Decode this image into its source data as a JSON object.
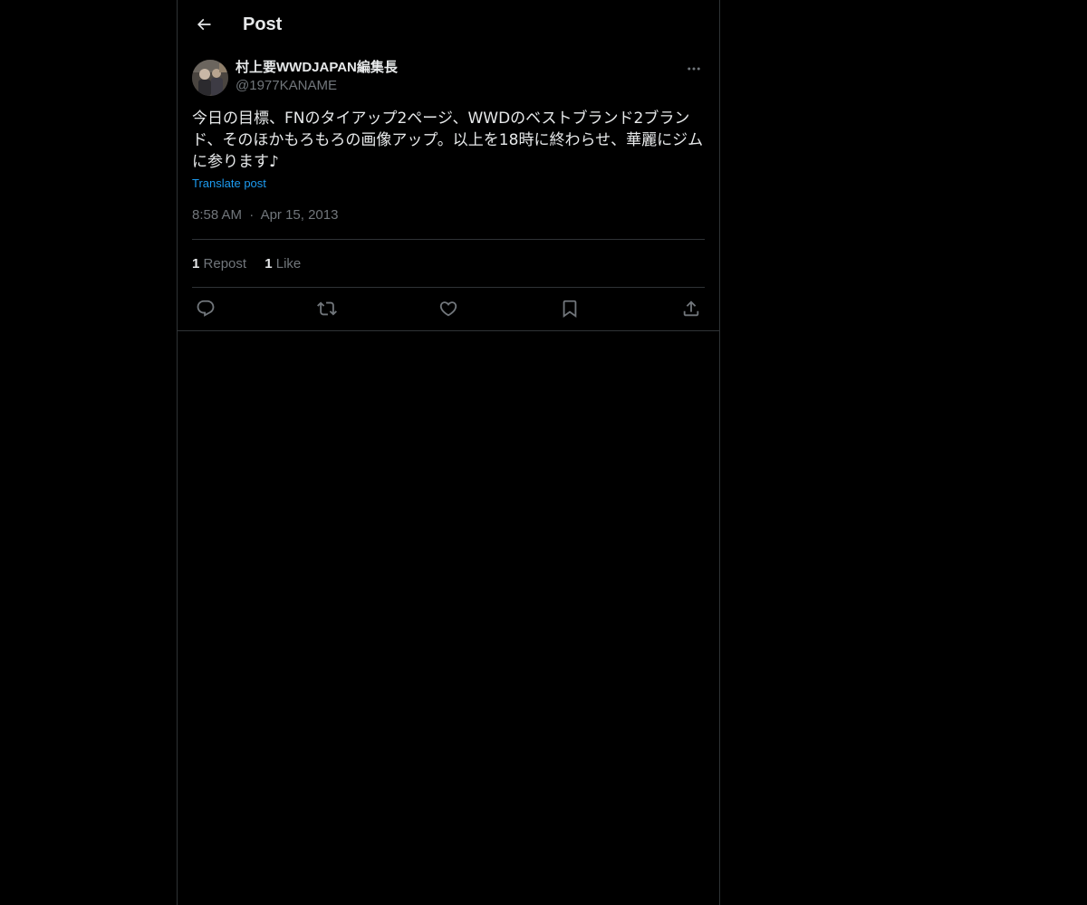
{
  "header": {
    "title": "Post"
  },
  "post": {
    "author": {
      "display_name": "村上要WWDJAPAN編集長",
      "handle": "@1977KANAME"
    },
    "text": "今日の目標、FNのタイアップ2ページ、WWDのベストブランド2ブランド、そのほかもろもろの画像アップ。以上を18時に終わらせ、華麗にジムに参ります♪",
    "translate_label": "Translate post",
    "time": "8:58 AM",
    "date": "Apr 15, 2013",
    "timestamp_separator": "·",
    "stats": {
      "reposts_count": "1",
      "reposts_label": "Repost",
      "likes_count": "1",
      "likes_label": "Like"
    },
    "actions": {
      "icons": [
        "reply-icon",
        "repost-icon",
        "like-icon",
        "bookmark-icon",
        "share-icon"
      ]
    }
  },
  "colors": {
    "background": "#000000",
    "text_primary": "#e7e9ea",
    "text_secondary": "#71767b",
    "link": "#1d9bf0",
    "border": "#2f3336"
  }
}
